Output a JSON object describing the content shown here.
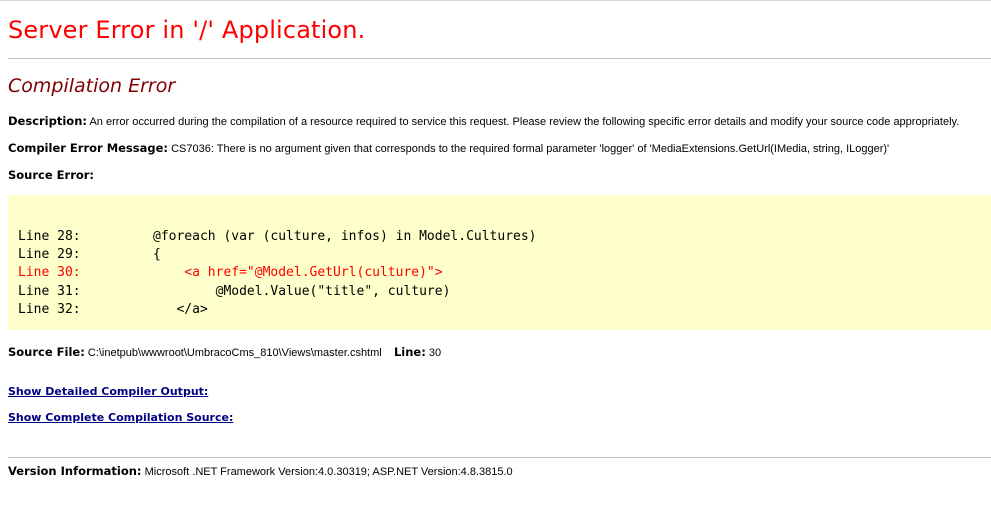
{
  "header": {
    "title": "Server Error in '/' Application.",
    "subtitle": "Compilation Error"
  },
  "description": {
    "label": "Description:",
    "text": "An error occurred during the compilation of a resource required to service this request. Please review the following specific error details and modify your source code appropriately."
  },
  "compiler_error": {
    "label": "Compiler Error Message:",
    "text": "CS7036: There is no argument given that corresponds to the required formal parameter 'logger' of 'MediaExtensions.GetUrl(IMedia, string, ILogger)'"
  },
  "source_error": {
    "label": "Source Error:",
    "lines": [
      {
        "number": "Line 28:",
        "code": "@foreach (var (culture, infos) in Model.Cultures)"
      },
      {
        "number": "Line 29:",
        "code": "{"
      },
      {
        "number": "Line 30:",
        "code": "    <a href=\"@Model.GetUrl(culture)\">"
      },
      {
        "number": "Line 31:",
        "code": "        @Model.Value(\"title\", culture)"
      },
      {
        "number": "Line 32:",
        "code": "   </a>"
      }
    ]
  },
  "source_file": {
    "label": "Source File:",
    "path": "C:\\inetpub\\wwwroot\\UmbracoCms_810\\Views\\master.cshtml",
    "line_label": "Line:",
    "line_value": "30"
  },
  "links": {
    "detailed_output": "Show Detailed Compiler Output:",
    "complete_source": "Show Complete Compilation Source:"
  },
  "version": {
    "label": "Version Information:",
    "text": "Microsoft .NET Framework Version:4.0.30319; ASP.NET Version:4.8.3815.0"
  },
  "colors": {
    "title": "#ff0000",
    "subtitle": "#800000",
    "code_background": "#ffffcc",
    "error_line": "#ff0000",
    "link": "#000080"
  }
}
